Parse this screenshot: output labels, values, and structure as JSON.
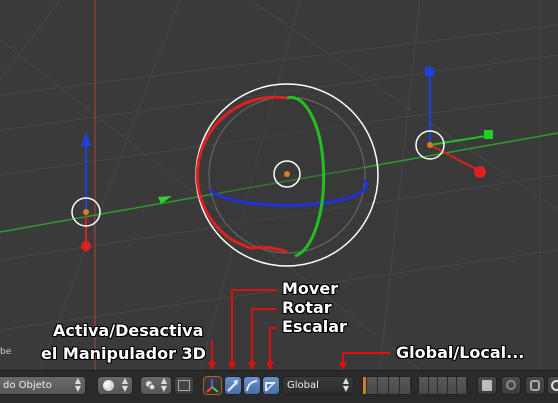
{
  "callouts": {
    "mover": "Mover",
    "rotar": "Rotar",
    "escalar": "Escalar",
    "activa_line1": "Activa/Desactiva",
    "activa_line2": "el Manipulador 3D",
    "global_local": "Global/Local..."
  },
  "header": {
    "mode_label": "do Objeto",
    "orientation_label": "Global",
    "edge_label": "be"
  },
  "colors": {
    "viewport_bg": "#3a3a3a",
    "grid": "#474747",
    "axis_x": "#e02020",
    "axis_y": "#20c020",
    "axis_z": "#2040e0",
    "callout_line": "#e01010"
  },
  "icons": [
    "viewport-shading-icon",
    "pivot-point-icon",
    "manipulator-toggle-icon",
    "translate-icon",
    "rotate-icon",
    "scale-icon",
    "layers-icon",
    "render-icon",
    "lock-icon",
    "search-icon"
  ]
}
